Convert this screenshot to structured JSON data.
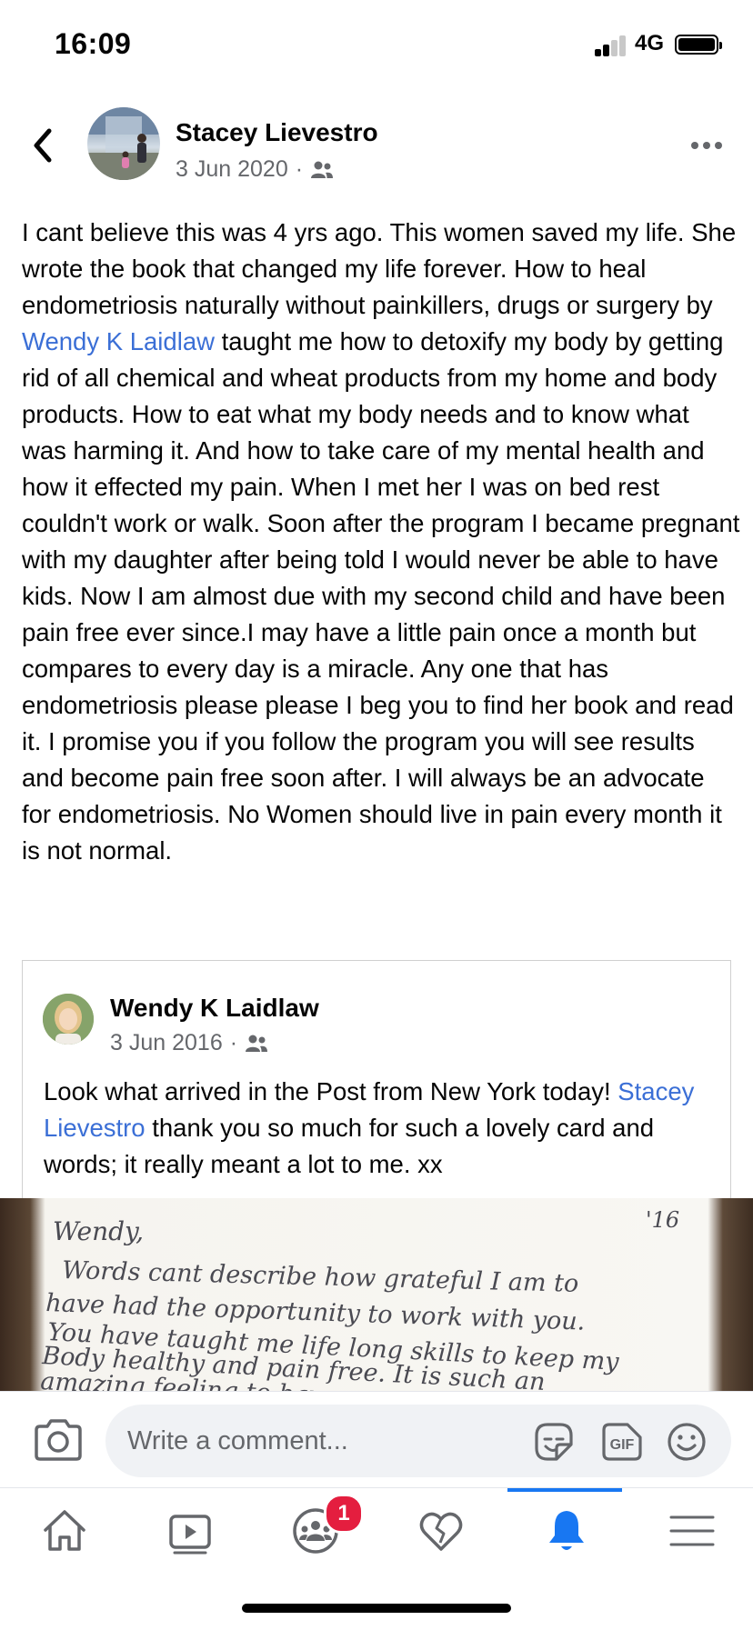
{
  "status_bar": {
    "time": "16:09",
    "network": "4G"
  },
  "post": {
    "author": "Stacey Lievestro",
    "date": "3 Jun 2020",
    "date_separator": "·",
    "audience_icon": "friends-icon",
    "text_before_link": "I cant believe this was 4 yrs ago. This women saved my life. She wrote the book that changed my life forever. How to heal endometriosis naturally without painkillers, drugs or surgery by ",
    "link": "Wendy K Laidlaw",
    "text_after_link": " taught me how to detoxify my body by getting rid of all chemical and wheat products from my home and body products. How to eat what my body needs and to know what was harming it. And how to take care of my mental health and how it effected my pain. When I met her I was on bed rest couldn't work or walk. Soon after the program I became pregnant with my daughter after being told I would never be able to have kids. Now I am almost due with my second child and have been pain free ever since.I may have a little pain once a month but compares to every day is a miracle. Any one that has endometriosis please please I beg you to find her book and read it. I promise you if you follow the program you will see results and become pain free soon after. I will always be an advocate for endometriosis. No Women should live in pain every month it is not normal."
  },
  "shared_post": {
    "author": "Wendy K Laidlaw",
    "date": "3 Jun 2016",
    "date_separator": "·",
    "text_before_link": "Look what arrived in the Post from New York today! ",
    "link": "Stacey Lievestro",
    "text_after_link": " thank you so much for such a lovely card and words; it really meant a lot to me. xx"
  },
  "note_image": {
    "lines": [
      "Wendy,",
      "Words cant describe how grateful I am to",
      "have had the opportunity to work with you.",
      "You have taught me life long skills to keep my",
      "Body healthy and pain free. It is such an",
      "amazing feeling to have"
    ],
    "year_mark": "'16"
  },
  "comment_bar": {
    "placeholder": "Write a comment...",
    "icons": [
      "camera-icon",
      "sticker-icon",
      "gif-icon",
      "emoji-icon"
    ],
    "gif_label": "GIF"
  },
  "tab_bar": {
    "tabs": [
      "home",
      "watch",
      "groups",
      "dating",
      "notifications",
      "menu"
    ],
    "active": "notifications",
    "groups_badge": "1",
    "accent_color": "#1877f2"
  },
  "colors": {
    "link": "#3b6fd6",
    "secondary_text": "#65676b",
    "badge": "#e41e3f"
  }
}
